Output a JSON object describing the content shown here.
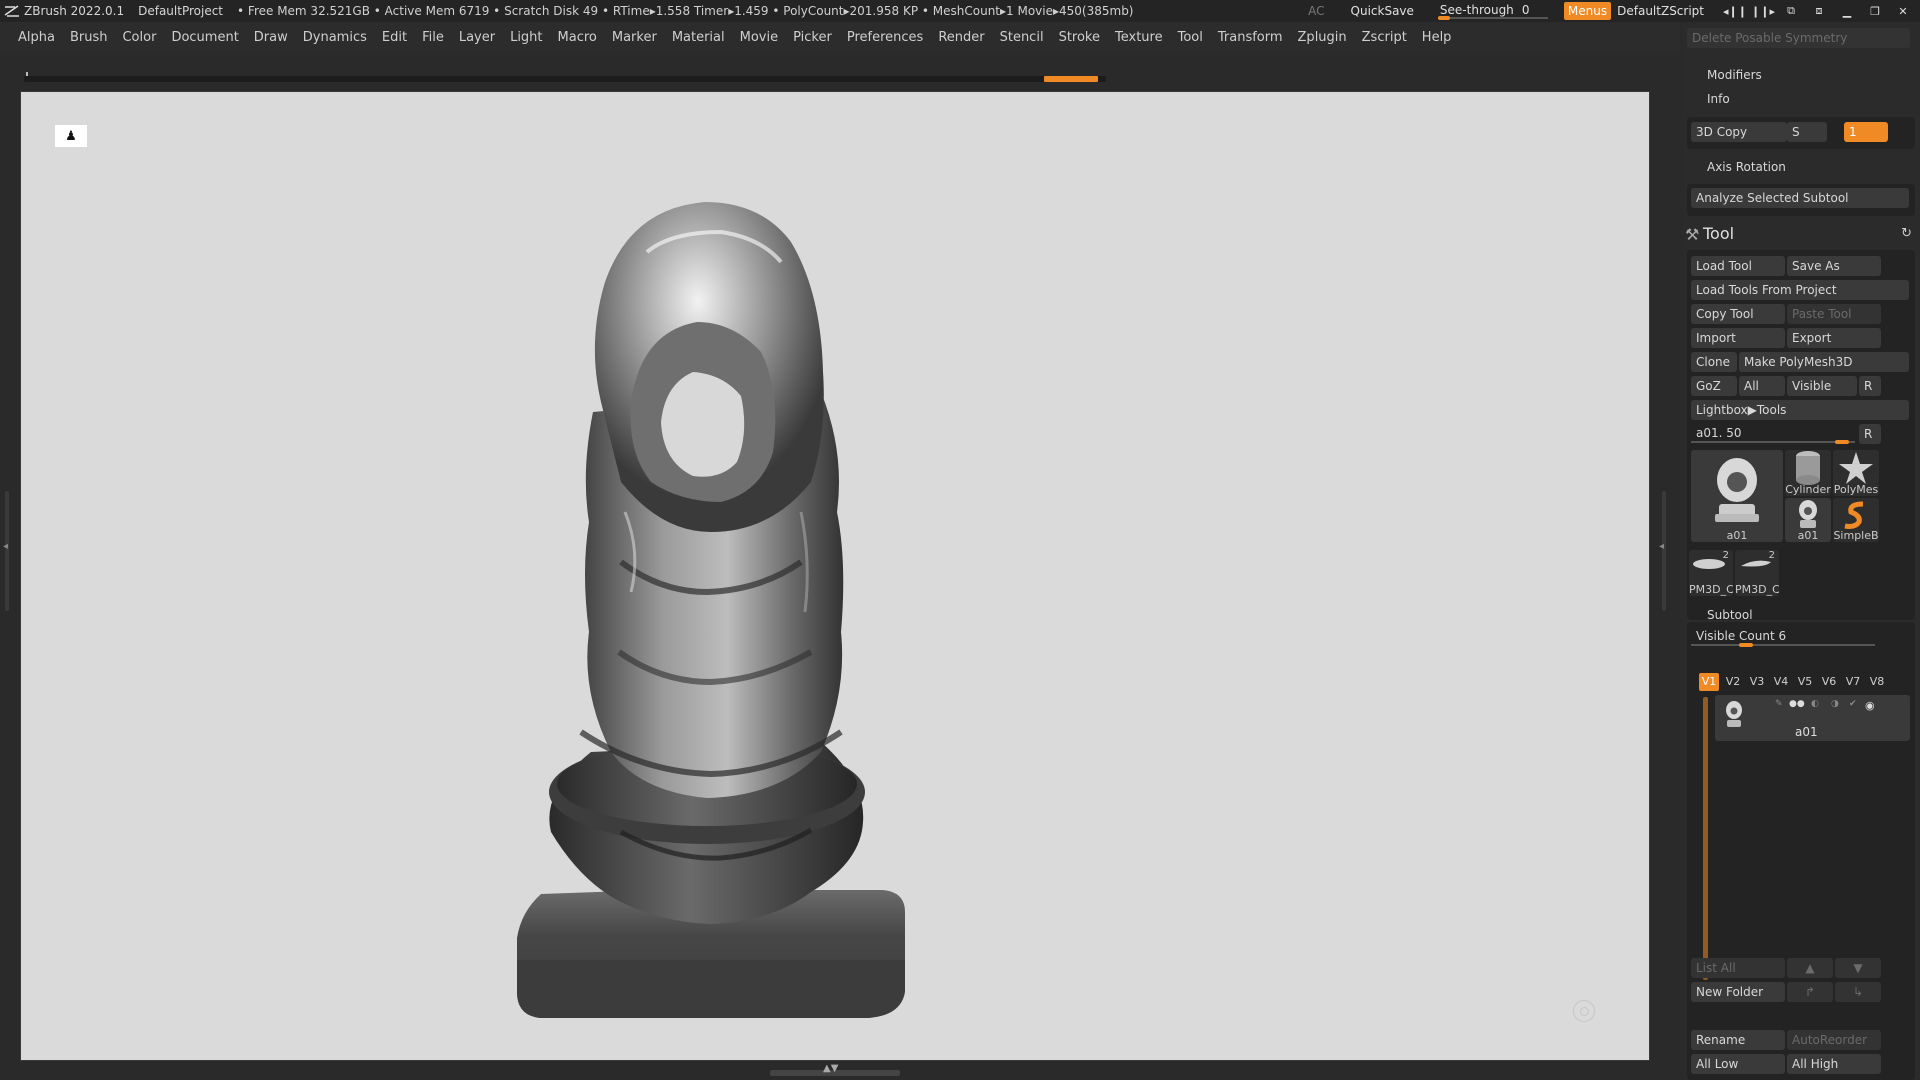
{
  "titlebar": {
    "app": "ZBrush 2022.0.1",
    "project": "DefaultProject",
    "stats": "• Free Mem 32.521GB • Active Mem 6719 • Scratch Disk 49 • RTime▸1.558 Timer▸1.459 • PolyCount▸201.958 KP • MeshCount▸1  Movie▸450(385mb)",
    "ac": "AC",
    "quicksave": "QuickSave",
    "seethrough_label": "See-through",
    "seethrough_value": "0",
    "seethrough_level": 0,
    "menus": "Menus",
    "default_zscript": "DefaultZScript",
    "icons": [
      "palette-wide-icon",
      "palette-narrow-icon",
      "window-left-icon",
      "window-right-icon",
      "minimize-icon",
      "maximize-icon",
      "close-icon"
    ]
  },
  "menubar": [
    "Alpha",
    "Brush",
    "Color",
    "Document",
    "Draw",
    "Dynamics",
    "Edit",
    "File",
    "Layer",
    "Light",
    "Macro",
    "Marker",
    "Material",
    "Movie",
    "Picker",
    "Preferences",
    "Render",
    "Stencil",
    "Stroke",
    "Texture",
    "Tool",
    "Transform",
    "Zplugin",
    "Zscript",
    "Help"
  ],
  "canvas": {
    "pin_icon": "pin-icon",
    "corner_icon": "navigation-icon",
    "accent": "#f08a24"
  },
  "palette": {
    "delete_posable_symmetry": "Delete Posable Symmetry",
    "modifiers": "Modifiers",
    "info": "Info",
    "copy3d": "3D Copy",
    "copy3d_s": "S",
    "copy3d_value": "1",
    "axis_rotation": "Axis Rotation",
    "analyze_selected_subtool": "Analyze Selected Subtool",
    "tool_title": "Tool",
    "load_tool": "Load Tool",
    "save_as": "Save As",
    "load_tools_from_project": "Load Tools From Project",
    "copy_tool": "Copy Tool",
    "paste_tool": "Paste Tool",
    "import": "Import",
    "export": "Export",
    "clone": "Clone",
    "make_polymesh3d": "Make PolyMesh3D",
    "goz": "GoZ",
    "all": "All",
    "visible": "Visible",
    "r": "R",
    "lightbox_tools": "Lightbox▶Tools",
    "tool_slider_label": "a01. 50",
    "tool_slider_level": 0.92,
    "thumbs": {
      "main": "a01",
      "cylinder": "Cylinder",
      "polymesh": "PolyMes",
      "a01_small": "a01",
      "simpleb": "SimpleB",
      "pm3d_1": "PM3D_C",
      "pm3d_2": "PM3D_C",
      "pm3d_1_count": "2",
      "pm3d_2_count": "2"
    },
    "subtool_title": "Subtool",
    "visible_count_label": "Visible Count 6",
    "visible_count_level": 0.3,
    "vtabs": [
      "V1",
      "V2",
      "V3",
      "V4",
      "V5",
      "V6",
      "V7",
      "V8"
    ],
    "subtool_item_name": "a01",
    "list_all": "List All",
    "new_folder": "New Folder",
    "rename": "Rename",
    "auto_reorder": "AutoReorder",
    "all_low": "All Low",
    "all_high": "All High"
  }
}
